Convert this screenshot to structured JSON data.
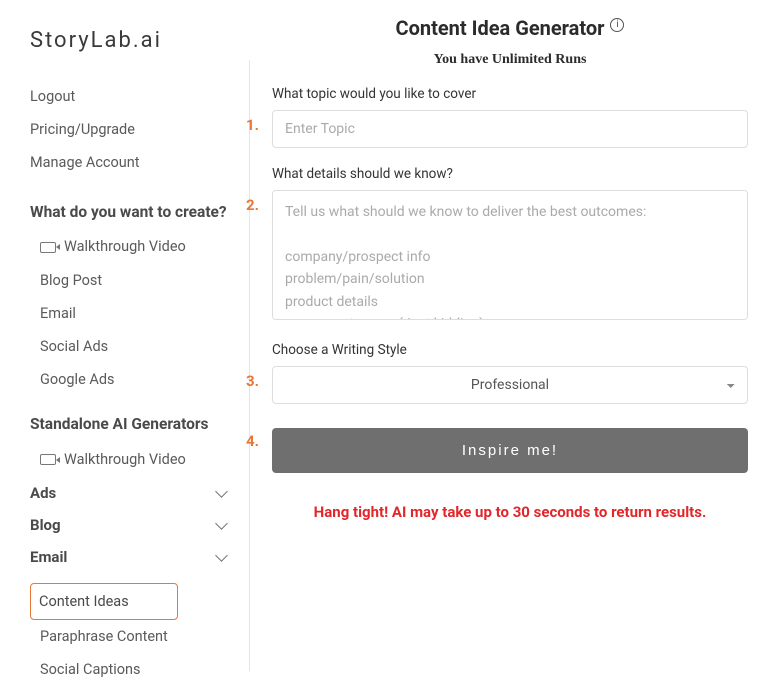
{
  "logo": "StoryLab.ai",
  "sidebar": {
    "account": [
      "Logout",
      "Pricing/Upgrade",
      "Manage Account"
    ],
    "heading_create": "What do you want to create?",
    "create": [
      {
        "label": "Walkthrough Video",
        "video": true
      },
      {
        "label": "Blog Post"
      },
      {
        "label": "Email"
      },
      {
        "label": "Social Ads"
      },
      {
        "label": "Google Ads"
      }
    ],
    "heading_standalone": "Standalone AI Generators",
    "standalone_walkthrough": "Walkthrough Video",
    "collapsible": [
      "Ads",
      "Blog",
      "Email"
    ],
    "bottom": [
      {
        "label": "Content Ideas",
        "selected": true
      },
      {
        "label": "Paraphrase Content"
      },
      {
        "label": "Social Captions"
      }
    ]
  },
  "main": {
    "title": "Content Idea Generator",
    "subtitle": "You have Unlimited Runs",
    "steps": [
      "1.",
      "2.",
      "3.",
      "4."
    ],
    "field1_label": "What topic would you like to cover",
    "field1_placeholder": "Enter Topic",
    "field2_label": "What details should we know?",
    "field2_placeholder": "Tell us what should we know to deliver the best outcomes:\n\ncompany/prospect info\nproblem/pain/solution\nproduct details\nyour secret sauce (Just kidding)",
    "field3_label": "Choose a Writing Style",
    "field3_value": "Professional",
    "button": "Inspire me!",
    "wait": "Hang tight! AI may take up to 30 seconds to return results."
  }
}
